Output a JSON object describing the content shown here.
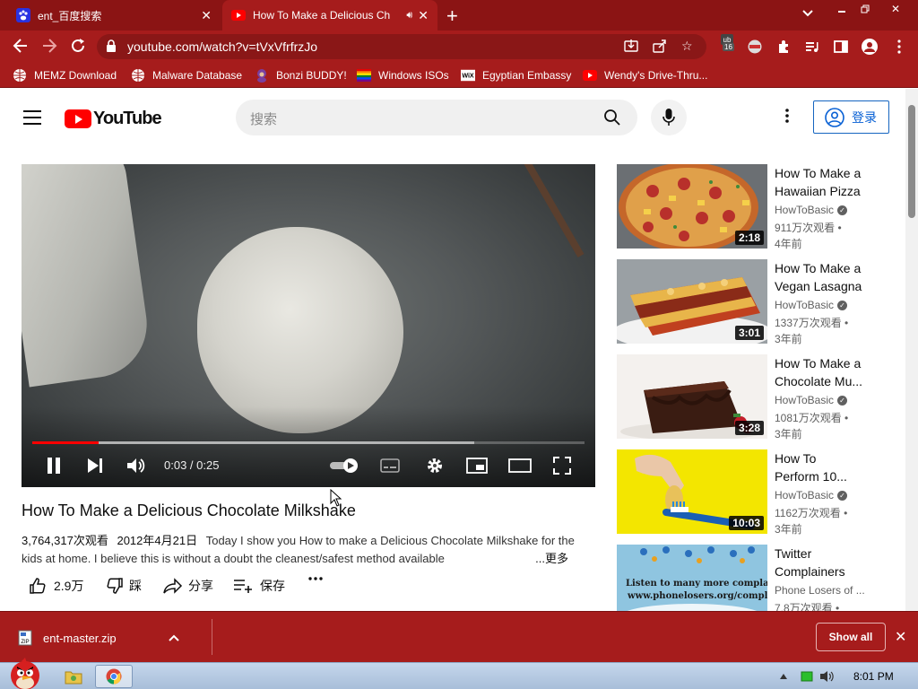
{
  "browser": {
    "tabs": [
      {
        "title": "ent_百度搜索",
        "active": false
      },
      {
        "title": "How To Make a Delicious Ch",
        "active": true
      }
    ],
    "new_tab": "+",
    "url": "youtube.com/watch?v=tVxVfrfrzJo",
    "extension_badge": "16",
    "theme_color": "#a61c1c"
  },
  "bookmarks": [
    {
      "label": "MEMZ Download",
      "icon": "globe-icon"
    },
    {
      "label": "Malware Database",
      "icon": "globe-icon"
    },
    {
      "label": "Bonzi BUDDY!",
      "icon": "bonzi-icon"
    },
    {
      "label": "Windows ISOs",
      "icon": "windows-flag-icon"
    },
    {
      "label": "Egyptian Embassy",
      "icon": "wix-icon"
    },
    {
      "label": "Wendy's Drive-Thru...",
      "icon": "youtube-icon"
    }
  ],
  "youtube": {
    "logo_text": "YouTube",
    "search_placeholder": "搜索",
    "signin_label": "登录",
    "player": {
      "time": "0:03 / 0:25",
      "played_fraction": 0.12,
      "buffered_fraction": 0.8
    },
    "video": {
      "title": "How To Make a Delicious Chocolate Milkshake",
      "views": "3,764,317次观看",
      "date": "2012年4月21日",
      "description": "Today I show you How to make a Delicious Chocolate Milkshake for the kids at home. I believe this is without a doubt the cleanest/safest method available",
      "more_label": "...更多"
    },
    "actions": {
      "like_count": "2.9万",
      "dislike_label": "踩",
      "share_label": "分享",
      "save_label": "保存",
      "more_label": "..."
    },
    "recommendations": [
      {
        "title_line1": "How To Make a",
        "title_line2": "Hawaiian Pizza",
        "channel": "HowToBasic",
        "views": "911万次观看 •",
        "age": "4年前",
        "duration": "2:18"
      },
      {
        "title_line1": "How To Make a",
        "title_line2": "Vegan Lasagna",
        "channel": "HowToBasic",
        "views": "1337万次观看 •",
        "age": "3年前",
        "duration": "3:01"
      },
      {
        "title_line1": "How To Make a",
        "title_line2": "Chocolate Mu...",
        "channel": "HowToBasic",
        "views": "1081万次观看 •",
        "age": "3年前",
        "duration": "3:28"
      },
      {
        "title_line1": "How To",
        "title_line2": "Perform 10...",
        "channel": "HowToBasic",
        "views": "1162万次观看 •",
        "age": "3年前",
        "duration": "10:03"
      },
      {
        "title_line1": "Twitter",
        "title_line2": "Complainers",
        "channel": "Phone Losers of ...",
        "views": "7.8万次观看 •",
        "age": "",
        "duration": "",
        "thumb_text1": "Listen to many more complainers!",
        "thumb_text2": "www.phonelosers.org/complainers"
      }
    ]
  },
  "download_bar": {
    "file": "ent-master.zip",
    "show_all": "Show all"
  },
  "taskbar": {
    "clock": "8:01 PM"
  }
}
